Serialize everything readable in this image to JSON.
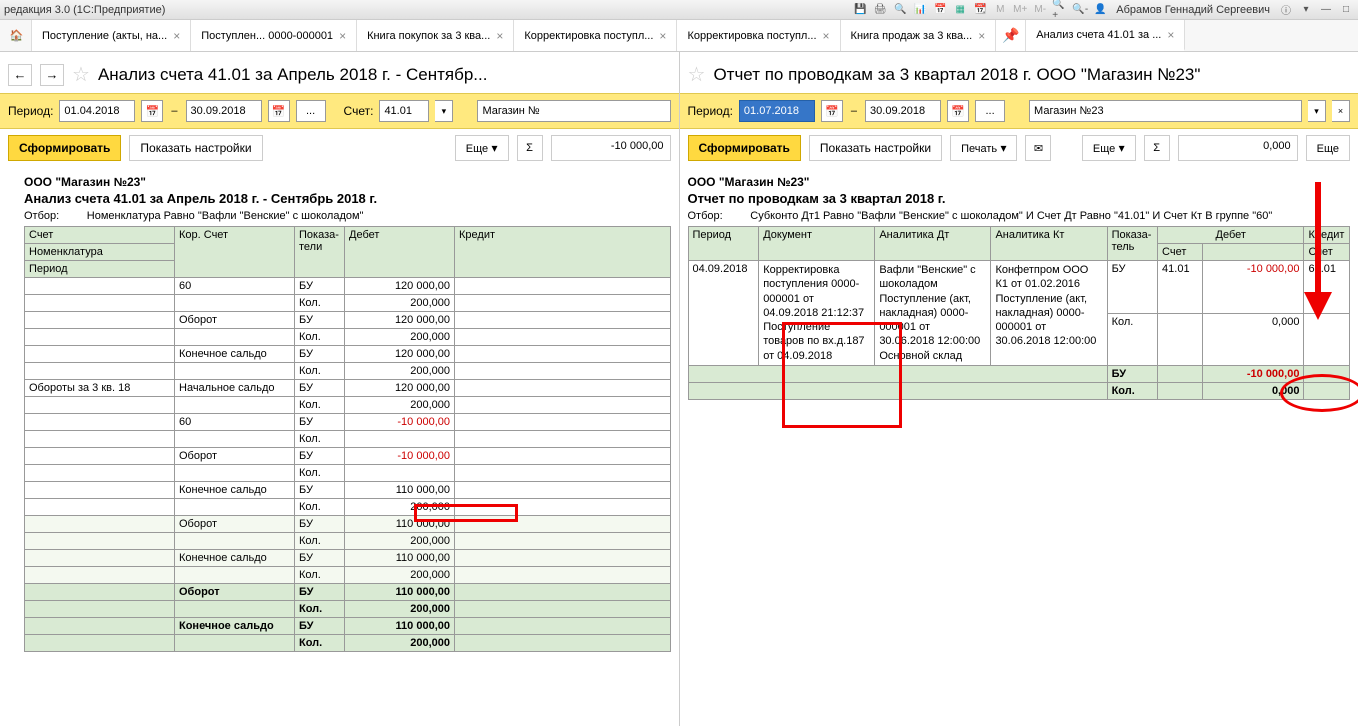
{
  "titlebar": {
    "app": "редакция 3.0  (1С:Предприятие)",
    "user": "Абрамов Геннадий Сергеевич"
  },
  "tabs": [
    {
      "label": "Поступление (акты, на..."
    },
    {
      "label": "Поступлен... 0000-000001"
    },
    {
      "label": "Книга покупок за 3 ква..."
    },
    {
      "label": "Корректировка поступл..."
    },
    {
      "label": "Корректировка поступл..."
    },
    {
      "label": "Книга продаж за 3 ква..."
    },
    {
      "label": "Анализ счета 41.01 за ..."
    }
  ],
  "left": {
    "title": "Анализ счета 41.01 за Апрель 2018 г. - Сентябр...",
    "period_label": "Период:",
    "date_from": "01.04.2018",
    "date_to": "30.09.2018",
    "account_label": "Счет:",
    "account": "41.01",
    "org": "Магазин №",
    "form_btn": "Сформировать",
    "settings_btn": "Показать настройки",
    "more_btn": "Еще",
    "sigma": "Σ",
    "sum": "-10 000,00",
    "report_org": "ООО \"Магазин №23\"",
    "report_title": "Анализ счета 41.01 за Апрель 2018 г. - Сентябрь 2018 г.",
    "filter_label": "Отбор:",
    "filter_text": "Номенклатура Равно \"Вафли \"Венские\" с шоколадом\"",
    "headers": {
      "account": "Счет",
      "nomenclature": "Номенклатура",
      "period": "Период",
      "cor_account": "Кор. Счет",
      "indicator": "Показа-\nтели",
      "debit": "Дебет",
      "credit": "Кредит"
    },
    "rows": [
      {
        "cor": "60",
        "ind": "БУ",
        "debit": "120 000,00"
      },
      {
        "cor": "",
        "ind": "Кол.",
        "debit": "200,000"
      },
      {
        "cor": "Оборот",
        "ind": "БУ",
        "debit": "120 000,00"
      },
      {
        "cor": "",
        "ind": "Кол.",
        "debit": "200,000"
      },
      {
        "cor": "Конечное сальдо",
        "ind": "БУ",
        "debit": "120 000,00"
      },
      {
        "cor": "",
        "ind": "Кол.",
        "debit": "200,000"
      },
      {
        "label": "Обороты за 3 кв. 18",
        "cor": "Начальное сальдо",
        "ind": "БУ",
        "debit": "120 000,00"
      },
      {
        "cor": "",
        "ind": "Кол.",
        "debit": "200,000"
      },
      {
        "cor": "60",
        "ind": "БУ",
        "debit": "-10 000,00",
        "neg": true,
        "hl": true
      },
      {
        "cor": "",
        "ind": "Кол."
      },
      {
        "cor": "Оборот",
        "ind": "БУ",
        "debit": "-10 000,00",
        "neg": true
      },
      {
        "cor": "",
        "ind": "Кол."
      },
      {
        "cor": "Конечное сальдо",
        "ind": "БУ",
        "debit": "110 000,00"
      },
      {
        "cor": "",
        "ind": "Кол.",
        "debit": "200,000"
      },
      {
        "cor": "Оборот",
        "ind": "БУ",
        "debit": "110 000,00",
        "sub": true
      },
      {
        "cor": "",
        "ind": "Кол.",
        "debit": "200,000",
        "sub": true
      },
      {
        "cor": "Конечное сальдо",
        "ind": "БУ",
        "debit": "110 000,00",
        "sub": true
      },
      {
        "cor": "",
        "ind": "Кол.",
        "debit": "200,000",
        "sub": true
      }
    ],
    "totals": [
      {
        "label": "Оборот",
        "ind": "БУ",
        "debit": "110 000,00"
      },
      {
        "label": "",
        "ind": "Кол.",
        "debit": "200,000"
      },
      {
        "label": "Конечное сальдо",
        "ind": "БУ",
        "debit": "110 000,00"
      },
      {
        "label": "",
        "ind": "Кол.",
        "debit": "200,000"
      }
    ]
  },
  "right": {
    "title": "Отчет по проводкам за 3 квартал 2018 г. ООО \"Магазин №23\"",
    "period_label": "Период:",
    "date_from": "01.07.2018",
    "date_to": "30.09.2018",
    "org": "Магазин №23",
    "form_btn": "Сформировать",
    "settings_btn": "Показать настройки",
    "print_btn": "Печать",
    "more_btn": "Еще",
    "more_btn2": "Еще",
    "sigma": "Σ",
    "sum": "0,000",
    "report_org": "ООО \"Магазин №23\"",
    "report_title": "Отчет по проводкам за 3 квартал 2018 г.",
    "filter_label": "Отбор:",
    "filter_text": "Субконто Дт1 Равно \"Вафли \"Венские\" с шоколадом\" И Счет Дт Равно \"41.01\" И Счет Кт В группе \"60\"",
    "headers": {
      "period": "Период",
      "document": "Документ",
      "an_dt": "Аналитика Дт",
      "an_kt": "Аналитика Кт",
      "indicator": "Показа-\nтель",
      "debit": "Дебет",
      "credit": "Кредит",
      "account": "Счет",
      "account2": "Счет"
    },
    "row": {
      "date": "04.09.2018",
      "doc": "Корректировка поступления 0000-000001 от 04.09.2018 21:12:37 Поступление товаров по вх.д.187 от 04.09.2018",
      "an_dt": "Вафли \"Венские\" с шоколадом\nПоступление (акт, накладная) 0000-000001 от 30.06.2018 12:00:00\nОсновной склад",
      "an_kt": "Конфетпром ООО К1 от 01.02.2016\nПоступление (акт, накладная) 0000-000001 от 30.06.2018 12:00:00",
      "ind1": "БУ",
      "acc1": "41.01",
      "val1": "-10 000,00",
      "acc2": "60.01",
      "ind2": "Кол.",
      "val2": "0,000"
    },
    "totals": [
      {
        "ind": "БУ",
        "val": "-10 000,00"
      },
      {
        "ind": "Кол.",
        "val": "0,000"
      }
    ]
  }
}
